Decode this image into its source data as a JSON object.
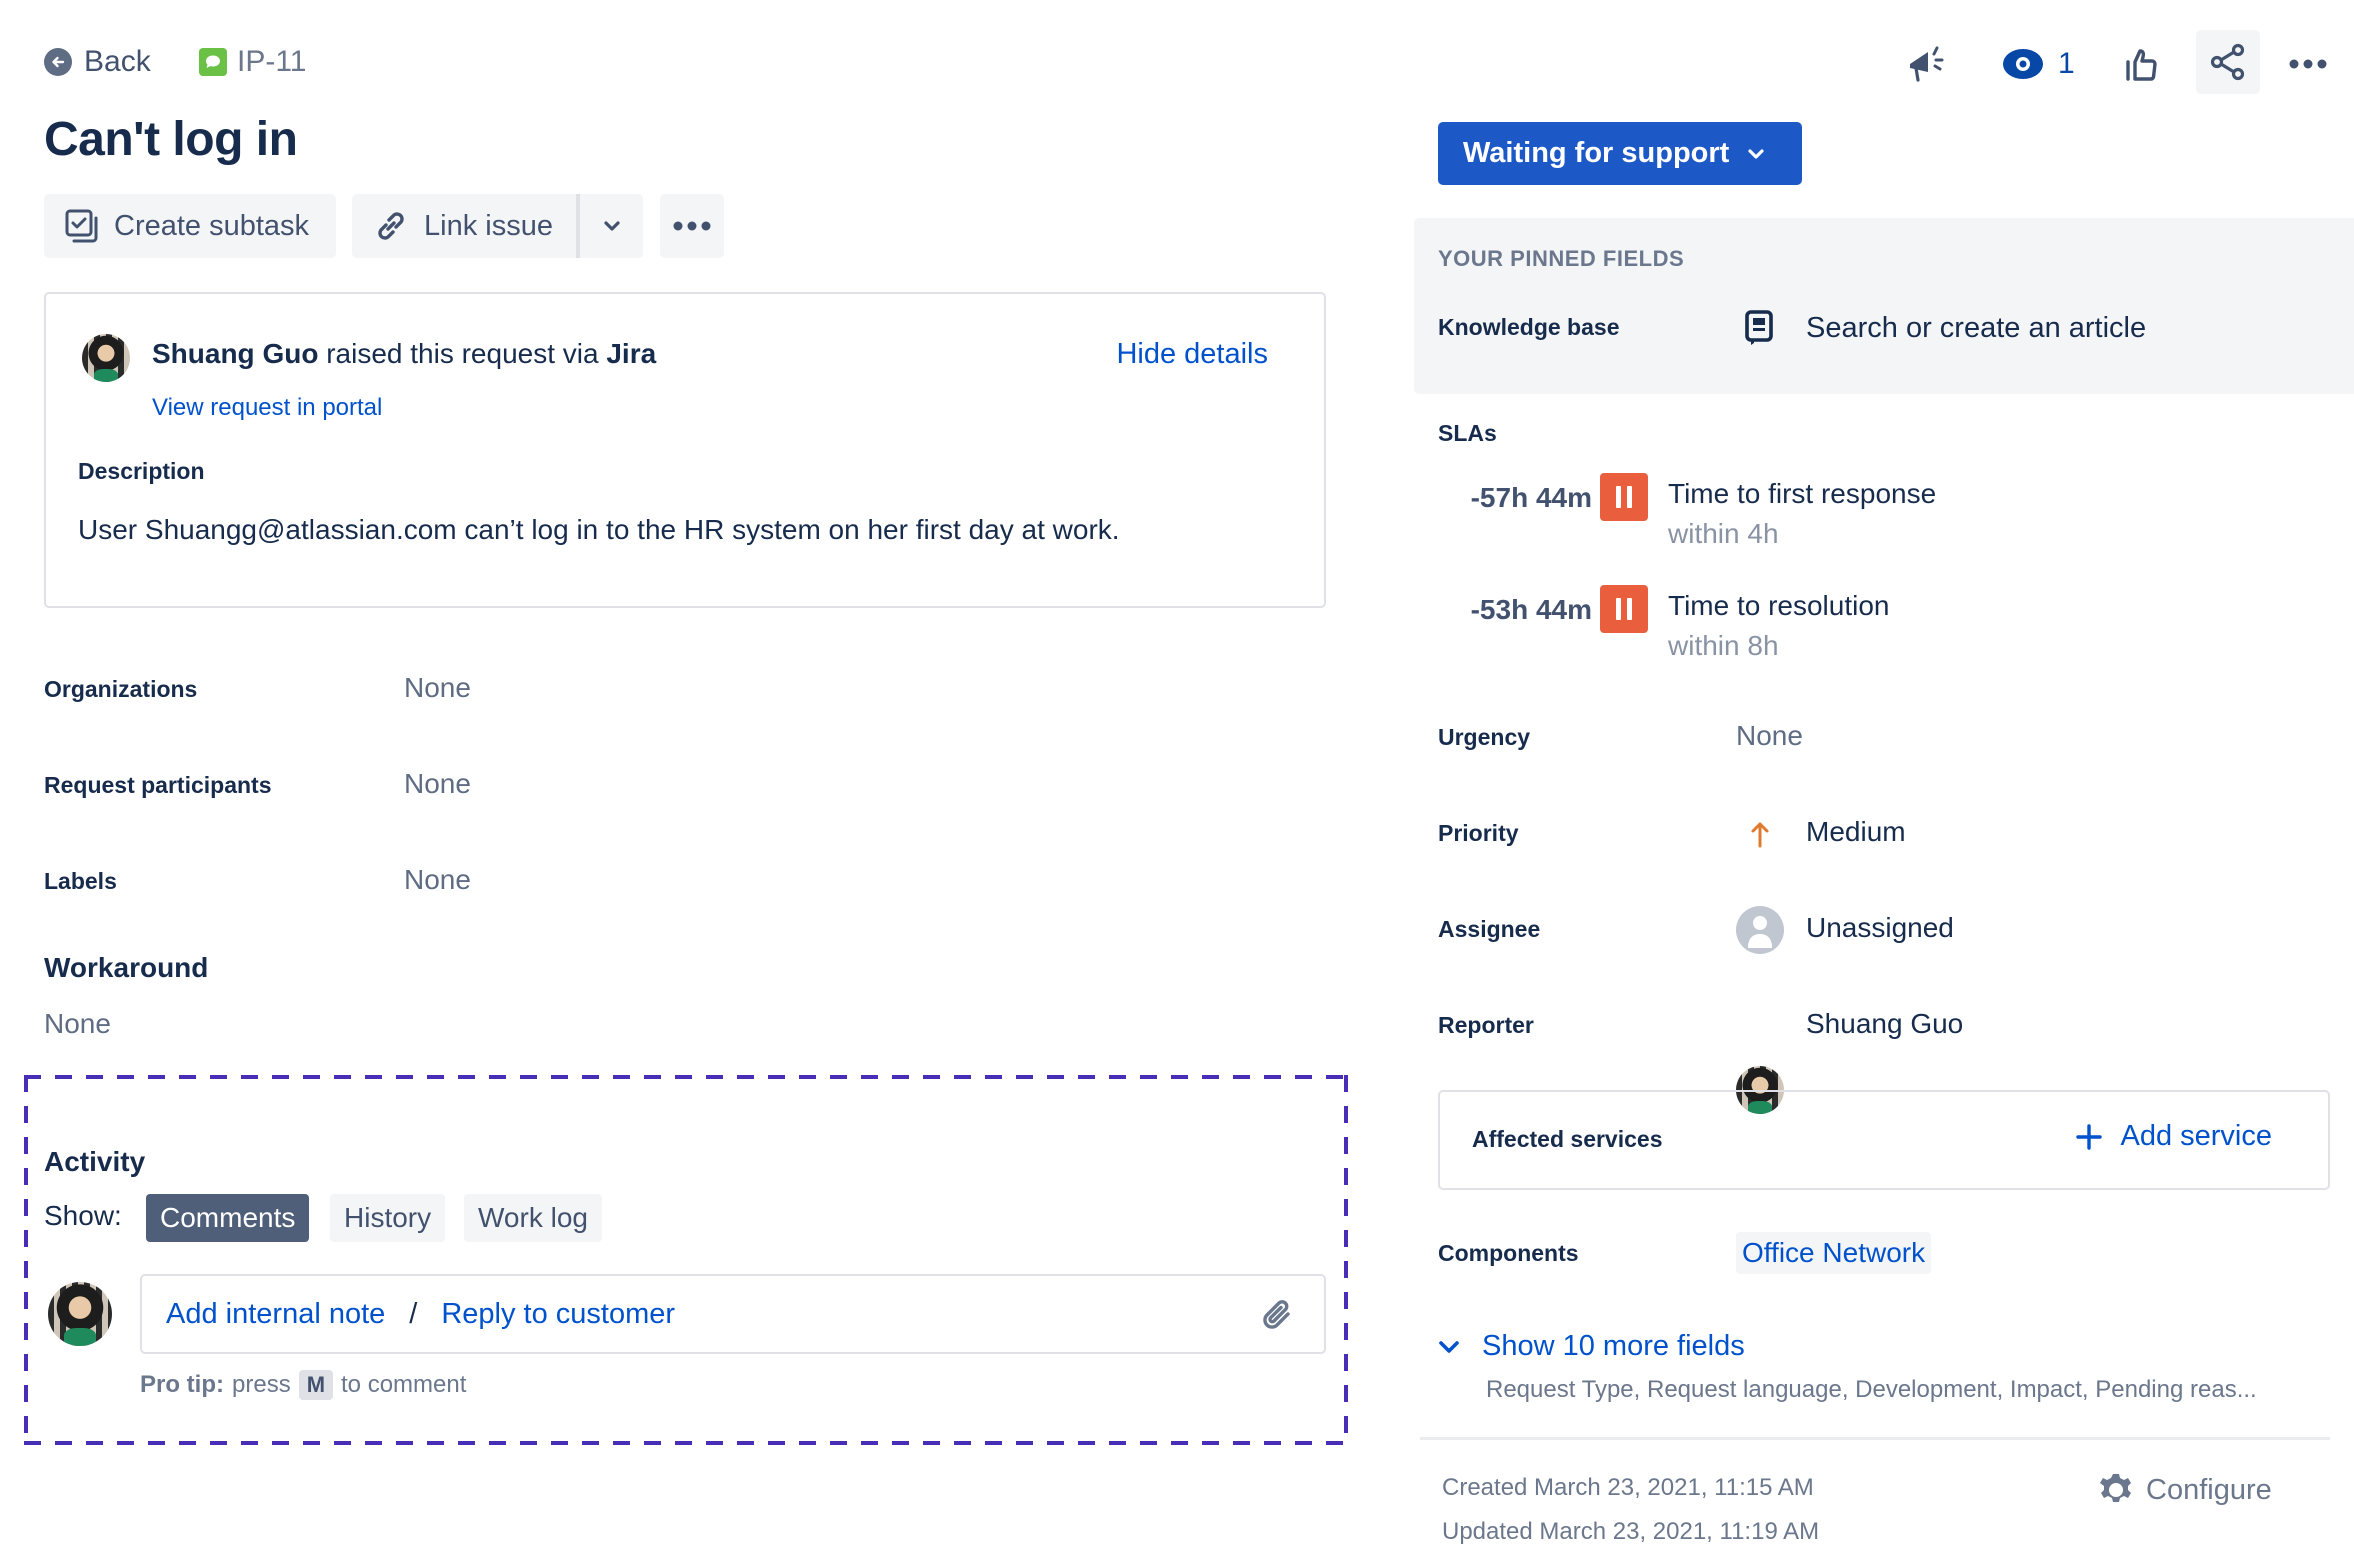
{
  "nav": {
    "back_label": "Back",
    "issue_key": "IP-11",
    "back_icon": "arrow-left-circle-icon",
    "issue_type_icon": "speech-bubble-icon"
  },
  "issue": {
    "title": "Can't log in"
  },
  "actions": {
    "create_subtask": "Create subtask",
    "link_issue": "Link issue"
  },
  "header_actions": {
    "watch_count": "1",
    "icons": [
      "megaphone-icon",
      "eye-icon",
      "thumbs-up-icon",
      "share-icon",
      "more-icon"
    ]
  },
  "request": {
    "reporter_name": "Shuang Guo",
    "raised_text": " raised this request via ",
    "channel": "Jira",
    "hide_details": "Hide details",
    "view_in_portal": "View request in portal",
    "description_label": "Description",
    "description": "User Shuangg@atlassian.com can’t log in to the HR system on her first day at work."
  },
  "left_fields": [
    {
      "label": "Organizations",
      "value": "None"
    },
    {
      "label": "Request participants",
      "value": "None"
    },
    {
      "label": "Labels",
      "value": "None"
    }
  ],
  "workaround": {
    "label": "Workaround",
    "value": "None"
  },
  "activity": {
    "title": "Activity",
    "show_label": "Show:",
    "filters": [
      {
        "label": "Comments",
        "active": true
      },
      {
        "label": "History",
        "active": false
      },
      {
        "label": "Work log",
        "active": false
      }
    ],
    "add_internal_note": "Add internal note",
    "separator": "/",
    "reply_to_customer": "Reply to customer",
    "pro_tip_bold": "Pro tip:",
    "pro_tip_press": "press",
    "pro_tip_key": "M",
    "pro_tip_rest": "to comment"
  },
  "status": {
    "label": "Waiting for support",
    "color": "#1D58C7"
  },
  "pinned": {
    "title": "YOUR PINNED FIELDS",
    "knowledge_base_label": "Knowledge base",
    "knowledge_base_value": "Search or create an article"
  },
  "slas": {
    "title": "SLAs",
    "items": [
      {
        "time": "-57h 44m",
        "name": "Time to first response",
        "goal": "within 4h",
        "state": "paused"
      },
      {
        "time": "-53h 44m",
        "name": "Time to resolution",
        "goal": "within 8h",
        "state": "paused"
      }
    ],
    "pause_color": "#E95F3E"
  },
  "right_fields": {
    "urgency": {
      "label": "Urgency",
      "value": "None"
    },
    "priority": {
      "label": "Priority",
      "value": "Medium",
      "color": "#E07A2F"
    },
    "assignee": {
      "label": "Assignee",
      "value": "Unassigned"
    },
    "reporter": {
      "label": "Reporter",
      "value": "Shuang Guo"
    }
  },
  "affected_services": {
    "label": "Affected services",
    "add_label": "Add service"
  },
  "components": {
    "label": "Components",
    "value": "Office Network"
  },
  "more_fields": {
    "label": "Show 10 more fields",
    "list": "Request Type, Request language, Development, Impact, Pending reas..."
  },
  "footer": {
    "created": "Created March 23, 2021, 11:15 AM",
    "updated": "Updated March 23, 2021, 11:19 AM",
    "configure": "Configure"
  }
}
